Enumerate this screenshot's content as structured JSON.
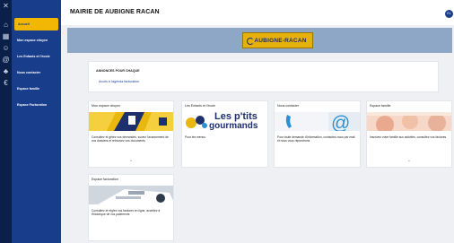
{
  "rail": {
    "icons": [
      "close-icon",
      "home-icon",
      "calendar-icon",
      "people-icon",
      "at-sign-icon",
      "family-icon",
      "euro-icon"
    ]
  },
  "sidebar": {
    "items": [
      {
        "label": "Accueil"
      },
      {
        "label": "Mon espace citoyen"
      },
      {
        "label": "Les Enfants et l'école"
      },
      {
        "label": "Nous contacter"
      },
      {
        "label": "Espace famille"
      },
      {
        "label": "Espace Facturation"
      }
    ]
  },
  "header": {
    "title": "MAIRIE DE AUBIGNE RACAN",
    "avatar": "EL"
  },
  "banner": {
    "logo_text": "AUBIGNE-RACAN"
  },
  "news": {
    "heading": "ANNONCES POUR CHAQUE",
    "link": "Accès à l'agenda facturation"
  },
  "cards": [
    {
      "title": "Mon espace citoyen",
      "text": "Consultez et gérez vos demandes, suivez l'avancement de vos dossiers et retrouvez vos documents"
    },
    {
      "title": "Les Enfants et l'école",
      "text": "Pour les menus",
      "logo_line1": "Les p'tits",
      "logo_line2": "gourmands"
    },
    {
      "title": "Nous contacter",
      "text": "Pour toute demande d'information, contactez-nous par mail et nous vous répondrons"
    },
    {
      "title": "Espace famille",
      "text": "Inscrivez votre famille aux activités, consultez vos factures"
    },
    {
      "title": "Espace facturation",
      "text": "Consultez et réglez vos factures en ligne, accédez à l'historique de vos paiements"
    }
  ],
  "colors": {
    "rail": "#0a1f4a",
    "sidebar": "#183d8a",
    "accent": "#f2b705",
    "banner": "#8ea7c7"
  }
}
